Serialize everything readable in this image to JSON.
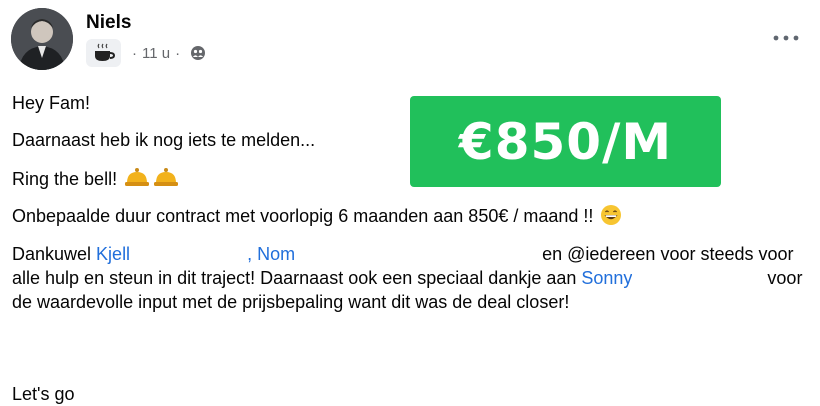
{
  "post": {
    "author": "Niels",
    "time": "11 u",
    "separator": "·",
    "mood_icon": "coffee-cup-icon",
    "audience_icon": "friends-icon",
    "menu_icon": "more-horizontal-icon",
    "lines": [
      "Hey Fam!",
      "Daarnaast heb ik nog iets te melden...",
      "Ring the bell!",
      "Onbepaalde duur contract met voorlopig 6 maanden aan 850€ / maand !!"
    ],
    "paragraph": {
      "start": "Dankuwel ",
      "mention_1": "Kjell",
      "sep_1": " , ",
      "mention_2": "Nom",
      "middle": " en @iedereen voor steeds voor alle hulp en steun in dit traject! Daarnaast ook een speciaal dankje aan ",
      "mention_3": "Sonny",
      "end": " voor de waardevolle input met de prijsbepaling want dit was de deal closer!"
    },
    "closing": "Let's go"
  },
  "banner": {
    "text": "€850/M",
    "background": "#21c05b",
    "color": "#ffffff"
  },
  "colors": {
    "mention": "#216fdb",
    "meta": "#65676b",
    "text": "#050505"
  }
}
